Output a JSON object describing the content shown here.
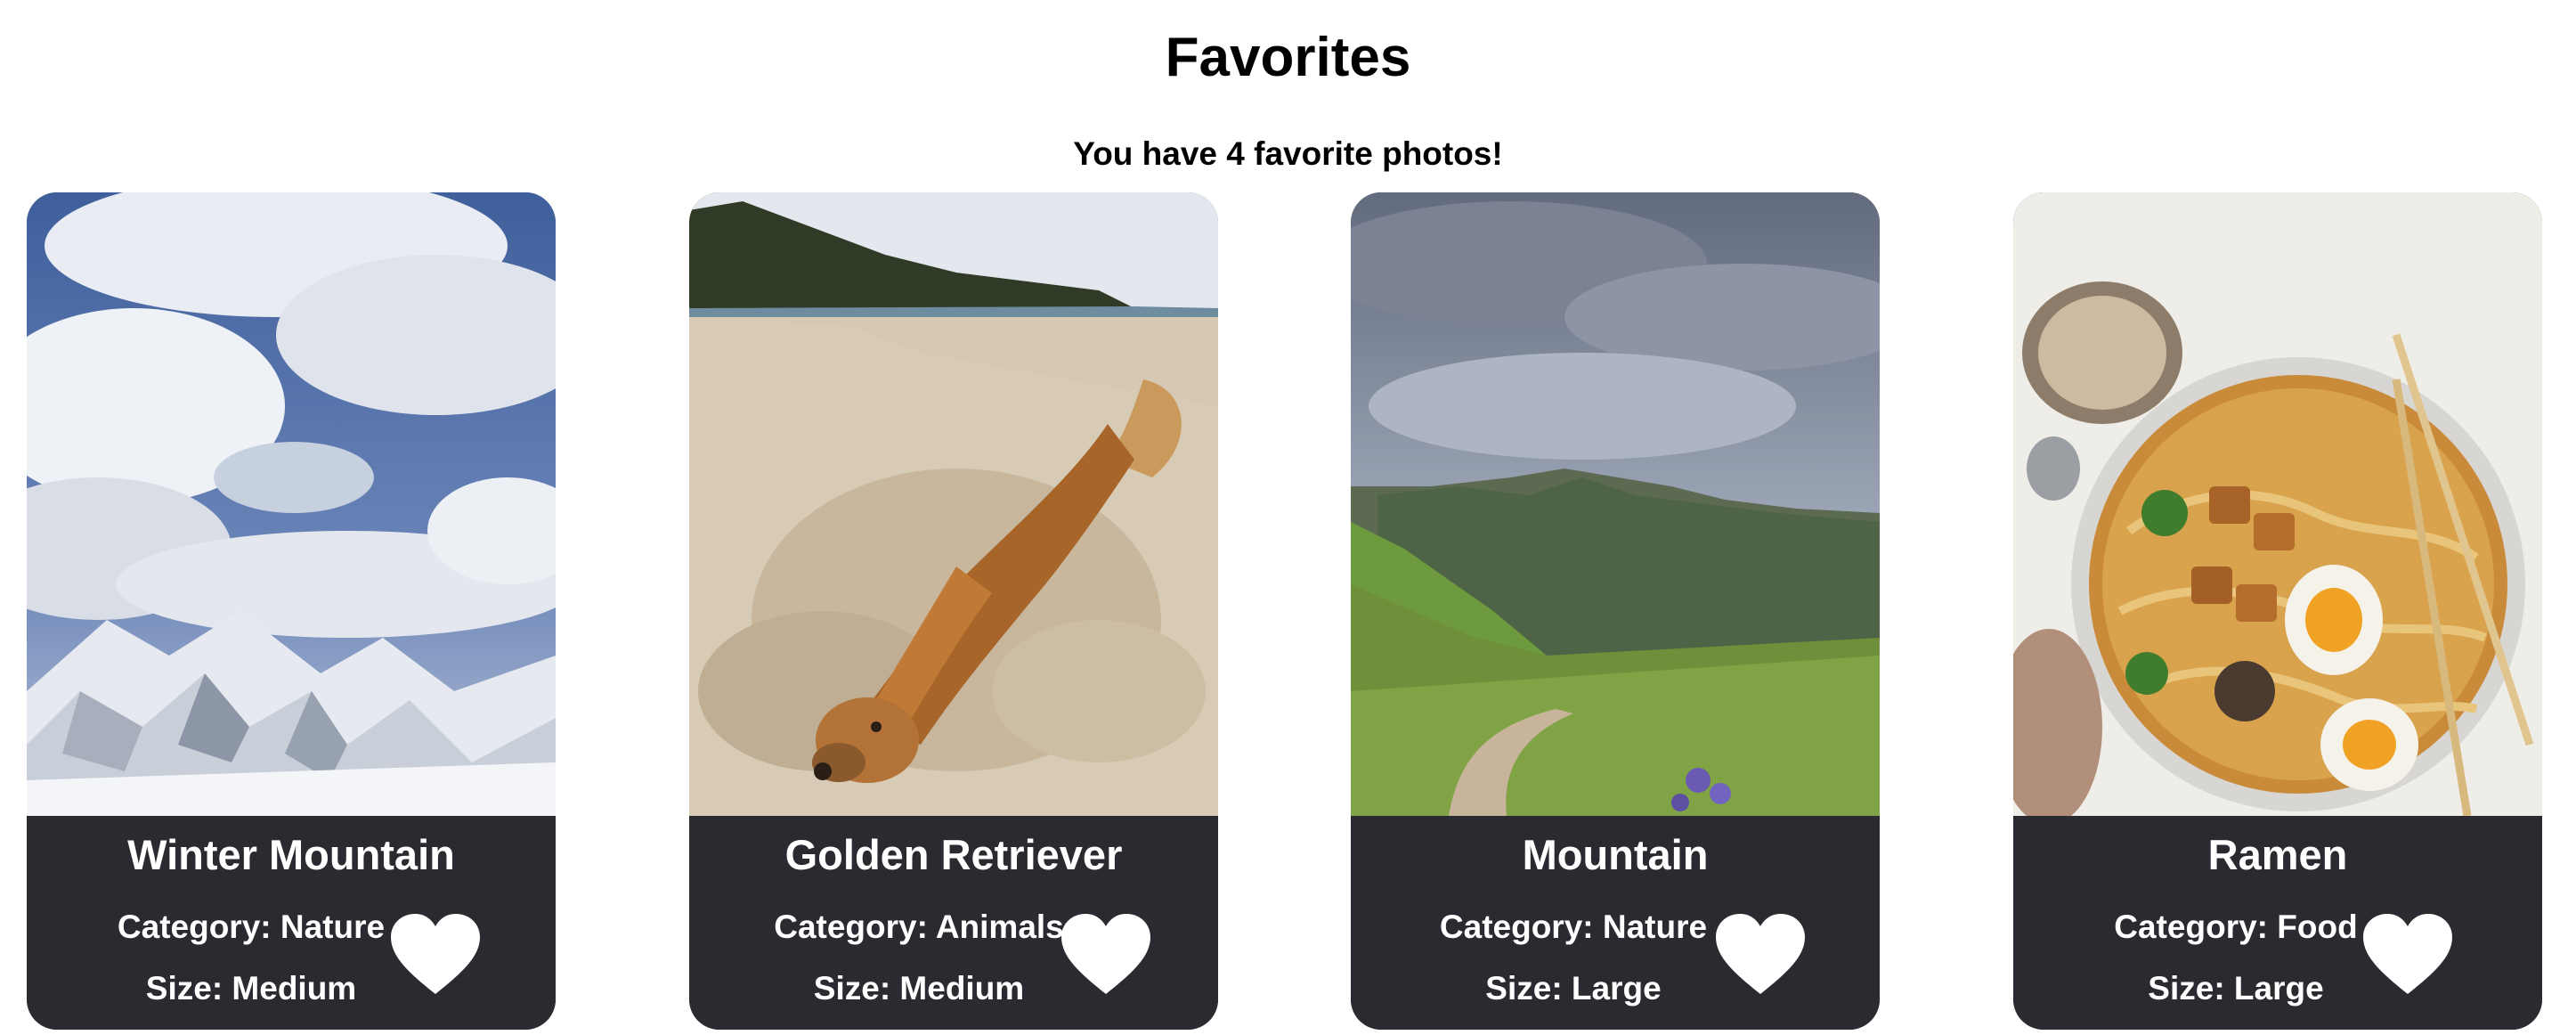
{
  "page": {
    "title": "Favorites",
    "subtitle": "You have 4 favorite photos!"
  },
  "colors": {
    "card_background": "#292b31",
    "text_light": "#ffffff",
    "heart": "#ffffff"
  },
  "cards": [
    {
      "title": "Winter Mountain",
      "category": "Category: Nature",
      "size": "Size: Medium",
      "image": "snowy-mountain-photo",
      "favorite_icon": "heart-icon"
    },
    {
      "title": "Golden Retriever",
      "category": "Category: Animals",
      "size": "Size: Medium",
      "image": "dog-on-beach-photo",
      "favorite_icon": "heart-icon"
    },
    {
      "title": "Mountain",
      "category": "Category: Nature",
      "size": "Size: Large",
      "image": "mountain-meadow-photo",
      "favorite_icon": "heart-icon"
    },
    {
      "title": "Ramen",
      "category": "Category: Food",
      "size": "Size: Large",
      "image": "ramen-bowl-photo",
      "favorite_icon": "heart-icon"
    }
  ]
}
